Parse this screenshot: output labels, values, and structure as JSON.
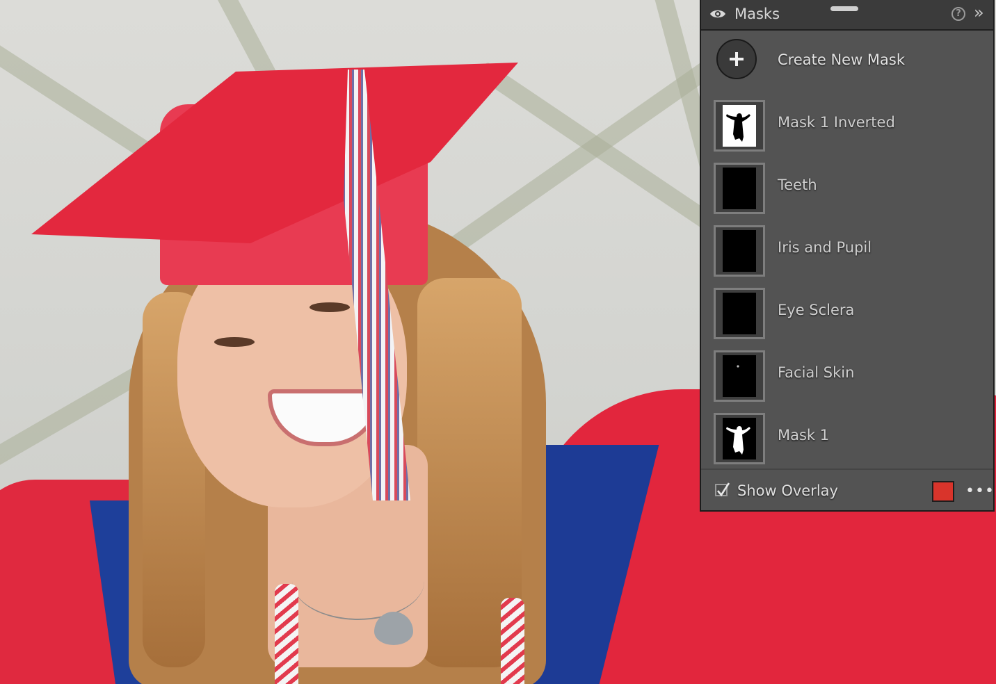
{
  "panel": {
    "title": "Masks",
    "help_symbol": "?",
    "collapse_symbol": "»",
    "create_label": "Create New Mask",
    "masks": [
      {
        "label": "Mask 1 Inverted",
        "thumbnail": "white-with-black-figure"
      },
      {
        "label": "Teeth",
        "thumbnail": "black"
      },
      {
        "label": "Iris and Pupil",
        "thumbnail": "black"
      },
      {
        "label": "Eye Sclera",
        "thumbnail": "black"
      },
      {
        "label": "Facial Skin",
        "thumbnail": "black-with-dot"
      },
      {
        "label": "Mask 1",
        "thumbnail": "black-with-white-figure"
      }
    ],
    "show_overlay_label": "Show Overlay",
    "show_overlay_checked": true,
    "overlay_color": "#d9342b",
    "more_symbol": "•••"
  },
  "colors": {
    "panel_bg": "#535353",
    "header_bg": "#3b3b3b",
    "gown_red": "#e2263d",
    "stole_blue": "#1d3b95"
  },
  "icons": {
    "visibility": "eye-icon",
    "help": "help-circle-icon",
    "collapse": "double-chevron-right-icon",
    "create": "plus-icon",
    "more": "more-horizontal-icon"
  }
}
